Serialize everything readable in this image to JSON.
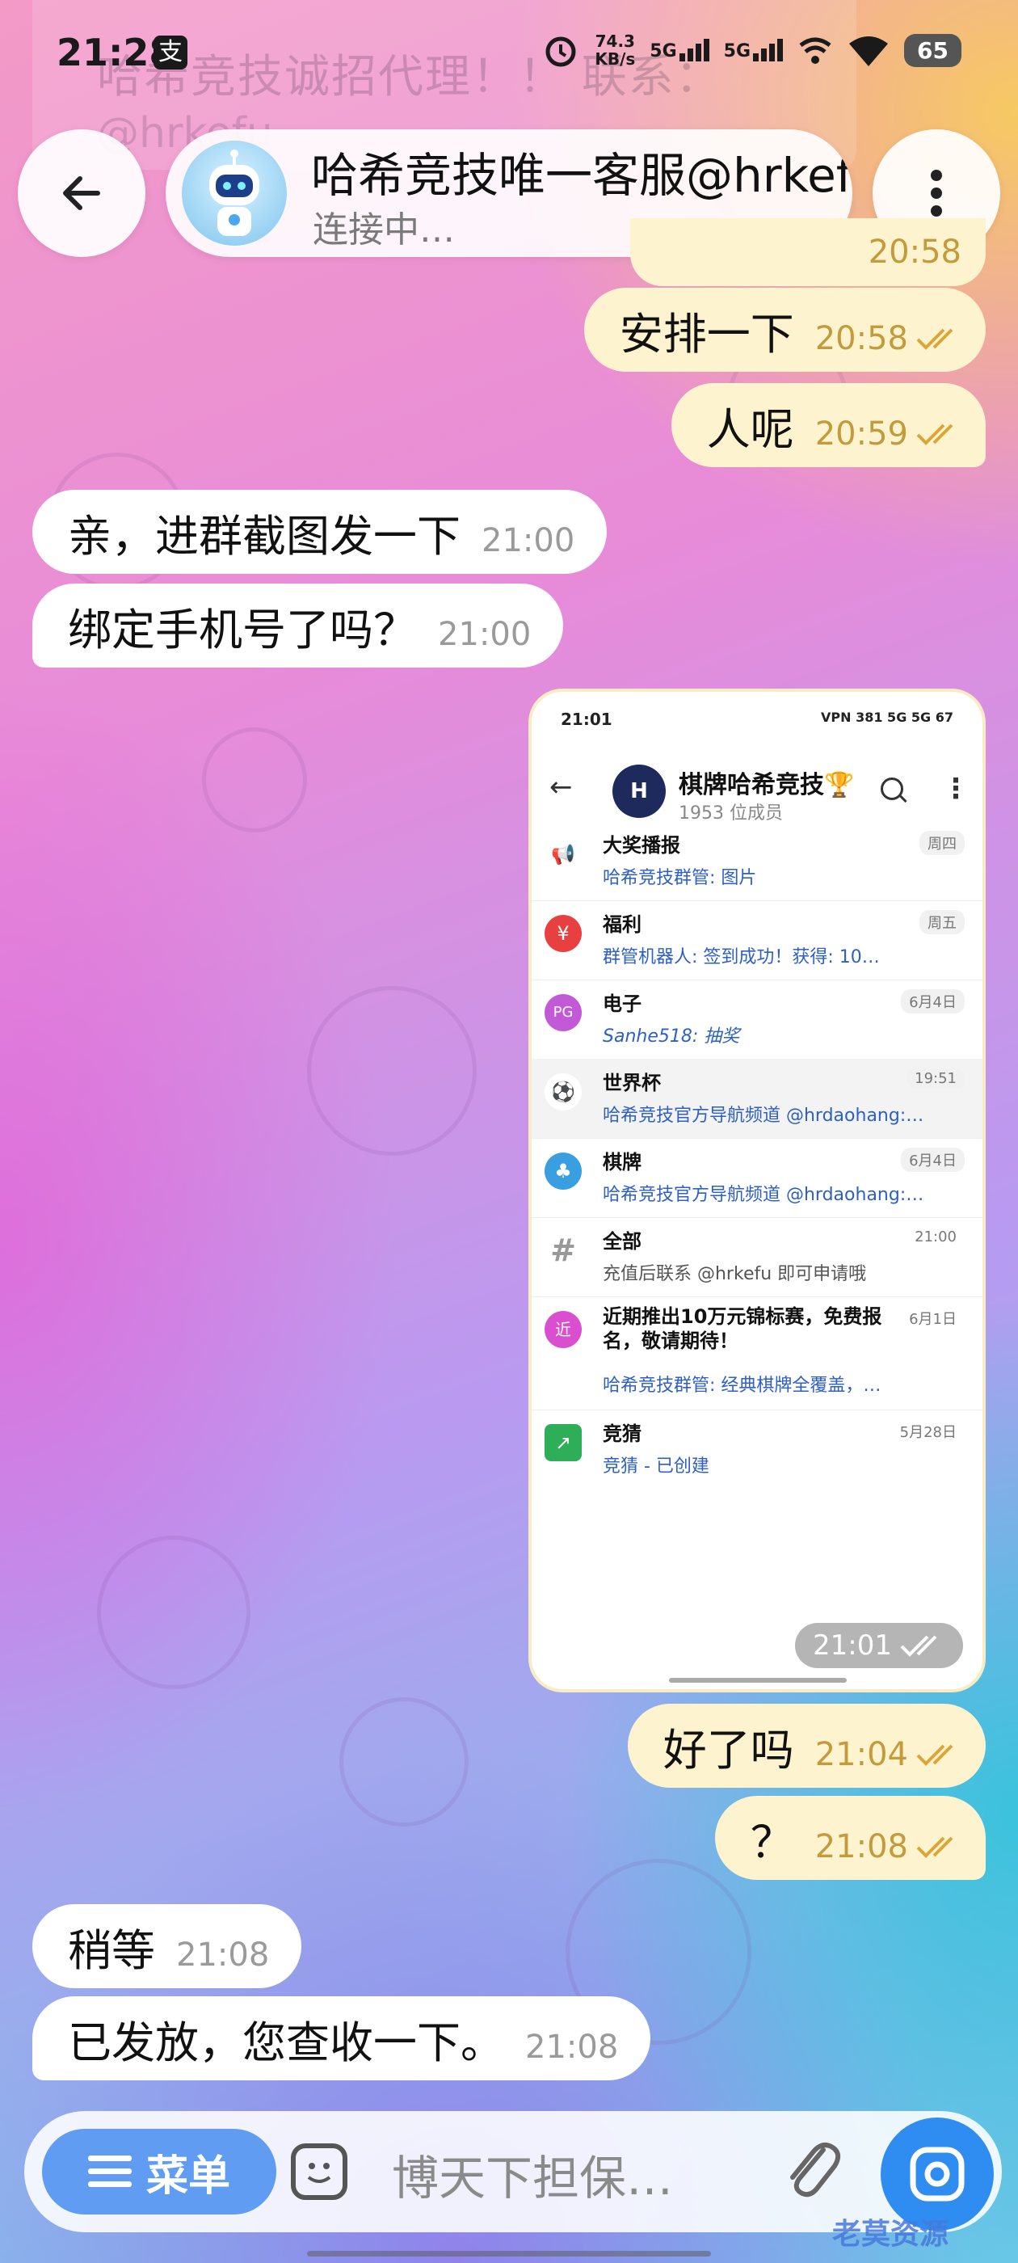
{
  "status_bar": {
    "time": "21:28",
    "pay_badge": "支",
    "net_speed_value": "74.3",
    "net_speed_unit": "KB/s",
    "sig1_label": "5G",
    "sig2_label": "5G",
    "battery": "65"
  },
  "pinned_banner": {
    "text": "哈希竞技诚招代理！！ 联系：",
    "handle": "@hrkefu"
  },
  "header": {
    "title": "哈希竞技唯一客服@hrkefu",
    "status": "连接中…",
    "ghost_time": "20:58"
  },
  "messages": [
    {
      "text": "安排一下",
      "time": "20:58"
    },
    {
      "text": "人呢",
      "time": "20:59"
    },
    {
      "text": "亲，进群截图发一下",
      "time": "21:00"
    },
    {
      "text": "绑定手机号了吗？",
      "time": "21:00"
    },
    {
      "text": "好了吗",
      "time": "21:04"
    },
    {
      "text": "？",
      "time": "21:08"
    },
    {
      "text": "稍等",
      "time": "21:08"
    },
    {
      "text": "已发放，您查收一下。",
      "time": "21:08"
    }
  ],
  "screenshot": {
    "status_time": "21:01",
    "status_right": "VPN 381 5G 5G 67",
    "group_avatar": "H",
    "group_title": "棋牌哈希竞技🏆",
    "group_members": "1953 位成员",
    "time": "21:01",
    "topics": [
      {
        "name": "大奖播报",
        "date": "周四",
        "msg": "哈希竞技群管: 图片",
        "icon": "📢"
      },
      {
        "name": "福利",
        "date": "周五",
        "msg": "群管机器人: 签到成功！获得: 10…",
        "icon": "¥"
      },
      {
        "name": "电子",
        "date": "6月4日",
        "msg": "Sanhe518: 抽奖",
        "icon": "PG"
      },
      {
        "name": "世界杯",
        "date": "19:51",
        "msg": "哈希竞技官方导航频道 @hrdaohang:…",
        "icon": "⚽"
      },
      {
        "name": "棋牌",
        "date": "6月4日",
        "msg": "哈希竞技官方导航频道 @hrdaohang:…",
        "icon": "♣"
      },
      {
        "name": "全部",
        "date": "21:00",
        "msg": "充值后联系 @hrkefu 即可申请哦",
        "icon": "#"
      },
      {
        "name": "近期推出10万元锦标赛，免费报名，敬请期待！",
        "date": "6月1日",
        "msg": "哈希竞技群管: 经典棋牌全覆盖，…",
        "icon": "近"
      },
      {
        "name": "竞猜",
        "date": "5月28日",
        "msg": "竞猜 - 已创建",
        "icon": "↗"
      }
    ]
  },
  "input_bar": {
    "menu_label": "菜单",
    "placeholder": "博天下担保…"
  },
  "watermark": "老莫资源",
  "colors": {
    "outgoing_bubble": "#fdf4cf",
    "incoming_bubble": "#ffffff",
    "outgoing_time": "#c39a3c",
    "menu_button": "#5f9cf2",
    "camera_button": "#2f8cf0"
  }
}
